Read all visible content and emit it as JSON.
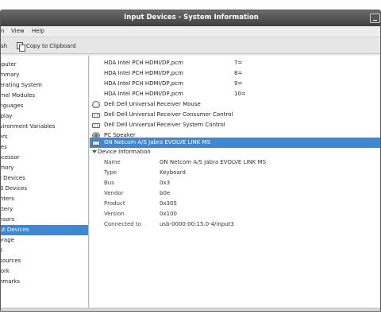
{
  "window": {
    "title": "Input Devices - System Information"
  },
  "menu": [
    {
      "label": "n"
    },
    {
      "label": "View"
    },
    {
      "label": "Help"
    }
  ],
  "toolbar": {
    "refresh_label": "sh",
    "copy_label": "Copy to Clipboard"
  },
  "sidebar": {
    "items": [
      {
        "label": "mputer"
      },
      {
        "label": "ummary"
      },
      {
        "label": "perating System"
      },
      {
        "label": "ernel Modules"
      },
      {
        "label": "anguages"
      },
      {
        "label": "isplay"
      },
      {
        "label": "nvironment Variables"
      },
      {
        "label": "sers"
      },
      {
        "label": "ices"
      },
      {
        "label": "rocessor"
      },
      {
        "label": "emory"
      },
      {
        "label": "CI Devices"
      },
      {
        "label": "SB Devices"
      },
      {
        "label": "rinters"
      },
      {
        "label": "attery"
      },
      {
        "label": "ensors"
      },
      {
        "label": "put Devices",
        "selected": true
      },
      {
        "label": "torage"
      },
      {
        "label": "MI"
      },
      {
        "label": "esources"
      },
      {
        "label": "work"
      },
      {
        "label": "chmarks"
      }
    ]
  },
  "devices": [
    {
      "name": "HDA Intel PCH HDMI/DP,pcm",
      "value": "7=",
      "icon": ""
    },
    {
      "name": "HDA Intel PCH HDMI/DP,pcm",
      "value": "8=",
      "icon": ""
    },
    {
      "name": "HDA Intel PCH HDMI/DP,pcm",
      "value": "9=",
      "icon": ""
    },
    {
      "name": "HDA Intel PCH HDMI/DP,pcm",
      "value": "10=",
      "icon": ""
    },
    {
      "name": "Dell Dell Universal Receiver Mouse",
      "value": "",
      "icon": "mouse-icon"
    },
    {
      "name": "Dell Dell Universal Receiver Consumer Control",
      "value": "",
      "icon": "keyboard-icon"
    },
    {
      "name": "Dell Dell Universal Receiver System Control",
      "value": "",
      "icon": "keyboard-icon"
    },
    {
      "name": "PC Speaker",
      "value": "",
      "icon": "speaker-icon"
    },
    {
      "name": "GN Netcom A/S Jabra EVOLVE LINK MS",
      "value": "",
      "icon": "keyboard-icon",
      "selected": true
    }
  ],
  "device_info": {
    "header": "Device Information",
    "rows": [
      {
        "key": "Name",
        "value": "GN Netcom A/S Jabra EVOLVE LINK MS"
      },
      {
        "key": "Type",
        "value": "Keyboard"
      },
      {
        "key": "Bus",
        "value": "0x3"
      },
      {
        "key": "Vendor",
        "value": "b0e"
      },
      {
        "key": "Product",
        "value": "0x305"
      },
      {
        "key": "Version",
        "value": "0x100"
      },
      {
        "key": "Connected to",
        "value": "usb-0000:00:15.0-4/input3"
      }
    ]
  },
  "colors": {
    "selection": "#3d87d8",
    "titlebar_top": "#6b6b6b",
    "titlebar_bottom": "#3f3f3f"
  }
}
